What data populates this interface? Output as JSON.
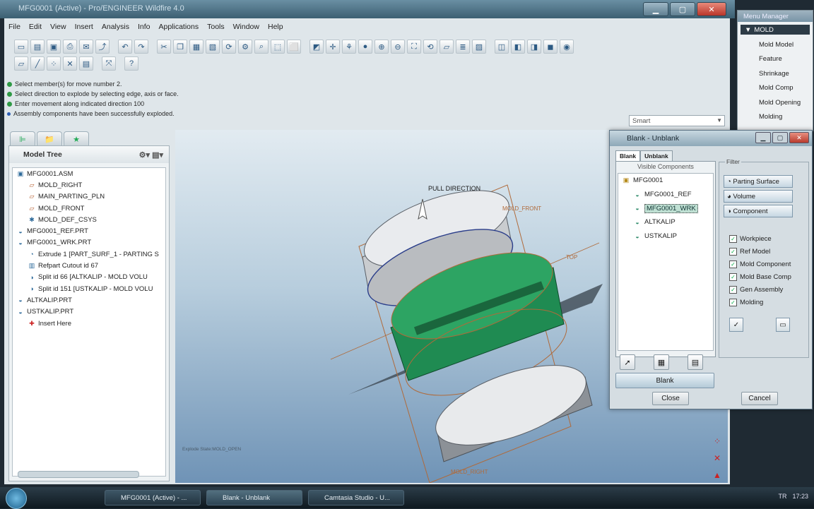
{
  "window": {
    "title": "MFG0001 (Active) - Pro/ENGINEER Wildfire 4.0"
  },
  "menu": [
    "File",
    "Edit",
    "View",
    "Insert",
    "Analysis",
    "Info",
    "Applications",
    "Tools",
    "Window",
    "Help"
  ],
  "messages": [
    "Select member(s) for move number 2.",
    "Select direction to explode by selecting edge, axis or face.",
    "Enter movement along indicated direction   100",
    "Assembly components have been successfully exploded."
  ],
  "smart_filter": "Smart",
  "model_tree": {
    "title": "Model Tree",
    "items": [
      {
        "label": "MFG0001.ASM",
        "icon": "assembly-icon",
        "indent": 0
      },
      {
        "label": "MOLD_RIGHT",
        "icon": "datum-plane-icon",
        "indent": 1
      },
      {
        "label": "MAIN_PARTING_PLN",
        "icon": "datum-plane-icon",
        "indent": 1
      },
      {
        "label": "MOLD_FRONT",
        "icon": "datum-plane-icon",
        "indent": 1
      },
      {
        "label": "MOLD_DEF_CSYS",
        "icon": "csys-icon",
        "indent": 1
      },
      {
        "label": "MFG0001_REF.PRT",
        "icon": "part-icon",
        "indent": 0
      },
      {
        "label": "MFG0001_WRK.PRT",
        "icon": "part-icon",
        "indent": 0
      },
      {
        "label": "Extrude 1 [PART_SURF_1 - PARTING S",
        "icon": "surface-icon",
        "indent": 1
      },
      {
        "label": "Refpart Cutout id 67",
        "icon": "cutout-icon",
        "indent": 1
      },
      {
        "label": "Split id 66 [ALTKALIP - MOLD VOLU",
        "icon": "split-icon",
        "indent": 1
      },
      {
        "label": "Split id 151 [USTKALIP - MOLD VOLU",
        "icon": "split-icon",
        "indent": 1
      },
      {
        "label": "ALTKALIP.PRT",
        "icon": "part-icon",
        "indent": 0
      },
      {
        "label": "USTKALIP.PRT",
        "icon": "part-icon",
        "indent": 0
      },
      {
        "label": "Insert Here",
        "icon": "insert-here-icon",
        "indent": 1
      }
    ]
  },
  "viewport": {
    "labels": {
      "pull_direction": "PULL DIRECTION",
      "mold_front": "MOLD_FRONT",
      "top": "TOP",
      "mold_right": "MOLD_RIGHT"
    },
    "explode_state": "Explode State:MOLD_OPEN"
  },
  "menu_manager": {
    "title": "Menu Manager",
    "header": "MOLD",
    "items": [
      "Mold Model",
      "Feature",
      "Shrinkage",
      "Mold Comp",
      "Mold Opening",
      "Molding"
    ]
  },
  "dialog": {
    "title": "Blank - Unblank",
    "tabs": [
      "Blank",
      "Unblank"
    ],
    "visible_components_label": "Visible Components",
    "components": [
      {
        "label": "MFG0001",
        "icon": "assembly-icon",
        "selected": false
      },
      {
        "label": "MFG0001_REF",
        "icon": "part-icon",
        "selected": false
      },
      {
        "label": "MFG0001_WRK",
        "icon": "part-icon",
        "selected": true
      },
      {
        "label": "ALTKALIP",
        "icon": "part-icon",
        "selected": false
      },
      {
        "label": "USTKALIP",
        "icon": "part-icon",
        "selected": false
      }
    ],
    "blank_button": "Blank",
    "close_button": "Close",
    "cancel_button": "Cancel",
    "filter": {
      "label": "Filter",
      "buttons": [
        "Parting Surface",
        "Volume",
        "Component"
      ],
      "checks": [
        "Workpiece",
        "Ref Model",
        "Mold Component",
        "Mold Base Comp",
        "Gen Assembly",
        "Molding"
      ]
    }
  },
  "taskbar": {
    "tasks": [
      "MFG0001 (Active) - ...",
      "Blank - Unblank",
      "Camtasia Studio - U..."
    ],
    "clock": "17:23",
    "lang": "TR"
  }
}
